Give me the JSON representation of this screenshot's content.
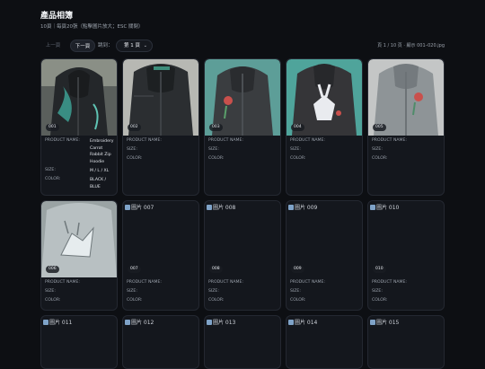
{
  "header": {
    "title": "產品相簿",
    "subtitle": "10頁｜每頁20張（點擊圖片放大；ESC 關閉）"
  },
  "toolbar": {
    "prev_label": "上一頁",
    "next_label": "下一頁",
    "jump_label": "跳到：",
    "page_select_value": "第 1 頁",
    "status": "頁 1 / 10 頁 · 顯示 001–020.jpg"
  },
  "labels": {
    "name": "PRODUCT NAME:",
    "size": "SIZE:",
    "color": "COLOR:"
  },
  "cards": [
    {
      "badge": "001",
      "name": "Embroidery Carrot Rabbit Zip Hoodie",
      "size": "M / L / XL",
      "color": "BLACK / BLUE",
      "image": "photo"
    },
    {
      "badge": "002",
      "name": "",
      "size": "",
      "color": "",
      "image": "photo"
    },
    {
      "badge": "003",
      "name": "",
      "size": "",
      "color": "",
      "image": "photo"
    },
    {
      "badge": "004",
      "name": "",
      "size": "",
      "color": "",
      "image": "photo"
    },
    {
      "badge": "005",
      "name": "",
      "size": "",
      "color": "",
      "image": "photo"
    },
    {
      "badge": "006",
      "name": "",
      "size": "",
      "color": "",
      "image": "photo"
    },
    {
      "badge": "007",
      "alt": "圖片 007",
      "name": "",
      "size": "",
      "color": "",
      "image": "broken"
    },
    {
      "badge": "008",
      "alt": "圖片 008",
      "name": "",
      "size": "",
      "color": "",
      "image": "broken"
    },
    {
      "badge": "009",
      "alt": "圖片 009",
      "name": "",
      "size": "",
      "color": "",
      "image": "broken"
    },
    {
      "badge": "010",
      "alt": "圖片 010",
      "name": "",
      "size": "",
      "color": "",
      "image": "broken"
    },
    {
      "alt": "圖片 011",
      "image": "broken"
    },
    {
      "alt": "圖片 012",
      "image": "broken"
    },
    {
      "alt": "圖片 013",
      "image": "broken"
    },
    {
      "alt": "圖片 014",
      "image": "broken"
    },
    {
      "alt": "圖片 015",
      "image": "broken"
    }
  ]
}
